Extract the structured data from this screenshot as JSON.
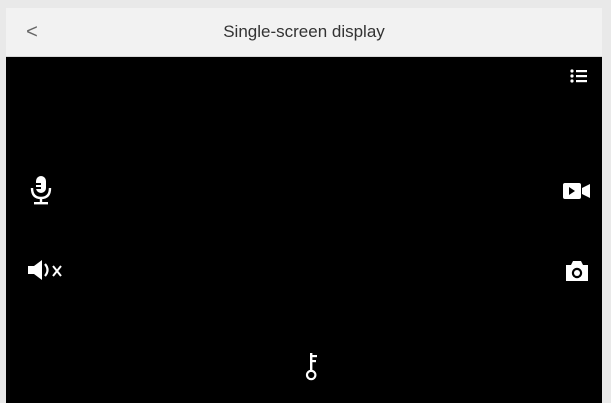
{
  "header": {
    "title": "Single-screen display",
    "back_label": "<"
  },
  "icons": {
    "menu": "list-icon",
    "microphone": "microphone-icon",
    "speaker_muted": "speaker-muted-icon",
    "video": "video-record-icon",
    "camera": "camera-icon",
    "key": "key-icon"
  },
  "colors": {
    "header_bg": "#f2f2f2",
    "screen_bg": "#000000",
    "icon_color": "#ffffff",
    "title_color": "#333333"
  }
}
